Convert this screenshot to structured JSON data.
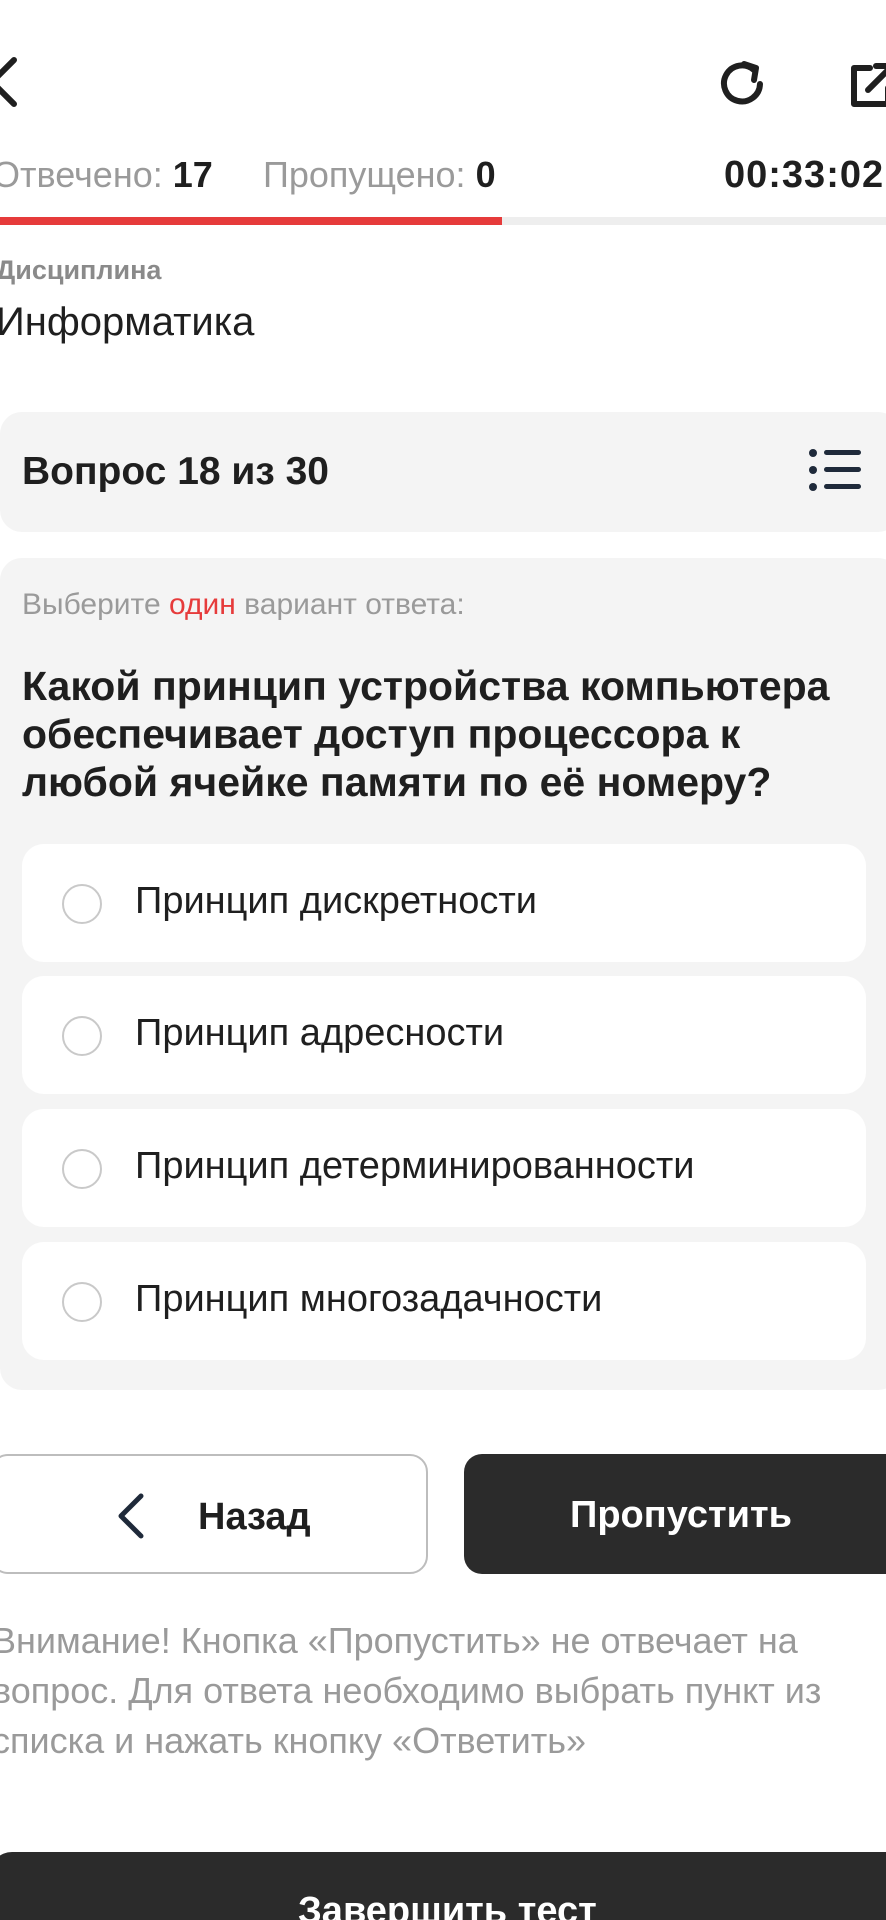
{
  "header": {
    "back_icon": "chevron-left-icon",
    "refresh_icon": "refresh-icon",
    "share_icon": "external-link-icon"
  },
  "stats": {
    "answered_label": "Отвечено:",
    "answered_value": "17",
    "skipped_label": "Пропущено:",
    "skipped_value": "0",
    "timer": "00:33:02"
  },
  "progress": {
    "fraction": 0.5667,
    "color": "#e63b3b"
  },
  "discipline": {
    "label": "Дисциплина",
    "name": "Информатика"
  },
  "question": {
    "number_text": "Вопрос 18 из 30",
    "list_icon": "list-icon",
    "instruction_before": "Выберите ",
    "instruction_accent": "один",
    "instruction_after": " вариант ответа:",
    "text": "Какой принцип устройства компьютера обеспечивает доступ процессора к любой ячейке памяти по её номеру?",
    "options": [
      {
        "label": "Принцип дискретности"
      },
      {
        "label": "Принцип адресности"
      },
      {
        "label": "Принцип детерминированности"
      },
      {
        "label": "Принцип многозадачности"
      }
    ]
  },
  "buttons": {
    "back_label": "Назад",
    "skip_label": "Пропустить",
    "finish_label": "Завершить тест"
  },
  "warning": "Внимание! Кнопка «Пропустить» не отвечает на вопрос. Для ответа необходимо выбрать пункт из списка и нажать кнопку «Ответить»",
  "colors": {
    "accent": "#e63b3b",
    "dark_button": "#2b2b2b",
    "card_bg": "#f4f4f4",
    "muted_text": "#9a9a9a"
  }
}
